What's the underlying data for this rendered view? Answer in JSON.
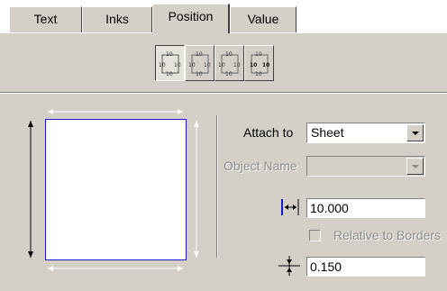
{
  "tabs": [
    {
      "label": "Text"
    },
    {
      "label": "Inks"
    },
    {
      "label": "Position"
    },
    {
      "label": "Value"
    }
  ],
  "active_tab": "Position",
  "mode_buttons": {
    "tick_label": "10"
  },
  "attach_to": {
    "label": "Attach to",
    "value": "Sheet"
  },
  "object_name": {
    "label": "Object Name",
    "value": ""
  },
  "offset": {
    "value": "10.000"
  },
  "relative_to_borders": {
    "label": "Relative to Borders",
    "checked": false
  },
  "spacing": {
    "value": "0.150"
  },
  "colors": {
    "panel": "#d4d0c8",
    "preview_border": "#1a1acc",
    "distance_icon": "#1a1acc"
  }
}
